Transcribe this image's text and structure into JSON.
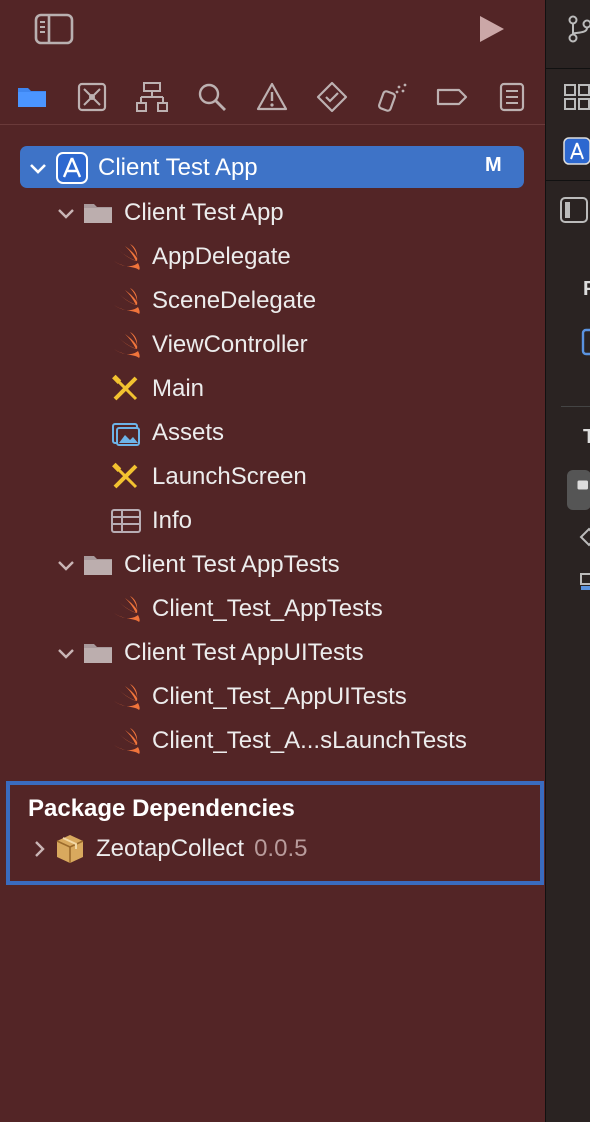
{
  "project_navigator": {
    "root": {
      "label": "Client Test App",
      "status_badge": "M"
    },
    "groups": [
      {
        "label": "Client Test App",
        "items": [
          "AppDelegate",
          "SceneDelegate",
          "ViewController",
          "Main",
          "Assets",
          "LaunchScreen",
          "Info"
        ]
      },
      {
        "label": "Client Test AppTests",
        "items": [
          "Client_Test_AppTests"
        ]
      },
      {
        "label": "Client Test AppUITests",
        "items": [
          "Client_Test_AppUITests",
          "Client_Test_A...sLaunchTests"
        ]
      }
    ]
  },
  "package_dependencies": {
    "title": "Package Dependencies",
    "packages": [
      {
        "name": "ZeotapCollect",
        "version": "0.0.5"
      }
    ]
  },
  "navigator_tabs": [
    "folder-icon",
    "source-control-icon",
    "hierarchy-icon",
    "search-icon",
    "warning-icon",
    "test-icon",
    "debug-icon",
    "breakpoint-icon",
    "report-icon"
  ],
  "right_pane": {
    "letters": [
      "P",
      "T"
    ]
  },
  "colors": {
    "background": "#532526",
    "selection": "#3e73c7",
    "accent": "#3a6bbf",
    "swift": "#f0743b"
  }
}
